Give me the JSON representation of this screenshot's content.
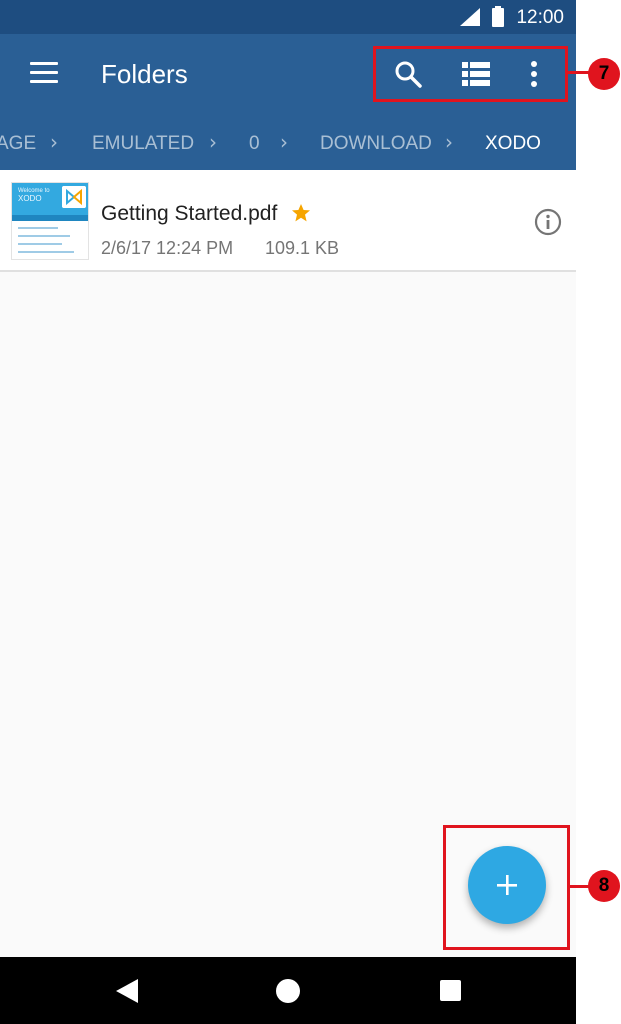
{
  "status_bar": {
    "time": "12:00"
  },
  "app_bar": {
    "title": "Folders",
    "icons": [
      "menu-icon",
      "search-icon",
      "list-view-icon",
      "overflow-menu-icon"
    ],
    "color": "#2a5f95"
  },
  "breadcrumb": {
    "items": [
      "AGE",
      "EMULATED",
      "0",
      "DOWNLOAD",
      "XODO"
    ],
    "separator": "›",
    "active_index": 4
  },
  "files": [
    {
      "name": "Getting Started.pdf",
      "starred": true,
      "date": "2/6/17 12:24 PM",
      "size": "109.1 KB",
      "thumbnail": {
        "line1": "Welcome to",
        "line2": "XODO"
      }
    }
  ],
  "fab": {
    "label": "+",
    "color": "#2ea8e3"
  },
  "annotations": [
    {
      "label": "7"
    },
    {
      "label": "8"
    }
  ],
  "colors": {
    "accent": "#2ea8e3",
    "star": "#f6a500",
    "annotation": "#e0141e"
  }
}
